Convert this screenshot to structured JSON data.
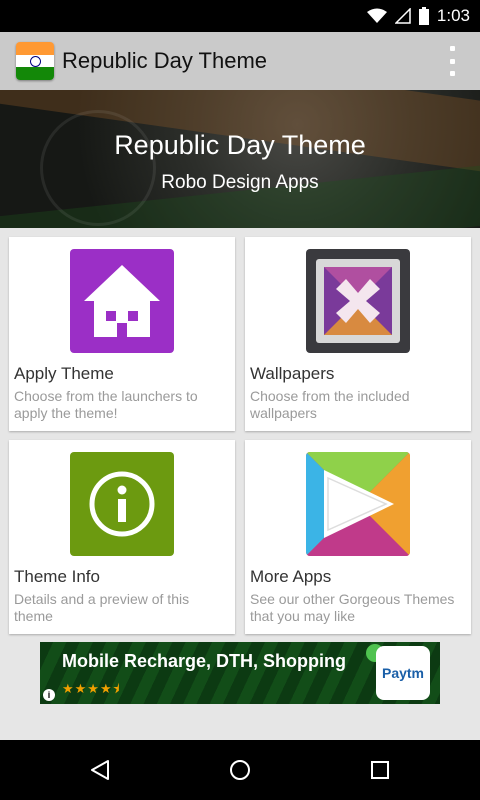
{
  "status_bar": {
    "time": "1:03",
    "icons": [
      "wifi-icon",
      "signal-icon",
      "battery-icon"
    ]
  },
  "action_bar": {
    "title": "Republic Day Theme",
    "icons": [
      "india-flag-icon",
      "overflow-menu-icon"
    ]
  },
  "hero": {
    "title": "Republic Day Theme",
    "subtitle": "Robo Design Apps"
  },
  "cards": [
    {
      "title": "Apply Theme",
      "description": "Choose from the launchers to apply the theme!",
      "icon": "home-icon",
      "color": "#9b2fc6"
    },
    {
      "title": "Wallpapers",
      "description": "Choose from the included wallpapers",
      "icon": "wallpaper-icon",
      "color": "#3a3a3e"
    },
    {
      "title": "Theme Info",
      "description": "Details and a preview of this theme",
      "icon": "info-icon",
      "color": "#6c9a10"
    },
    {
      "title": "More Apps",
      "description": "See our other Gorgeous Themes that you may like",
      "icon": "play-store-icon",
      "color": "#e04a3a"
    }
  ],
  "ad": {
    "title": "Mobile Recharge, DTH, Shopping",
    "stars": "★★★★⯨",
    "brand": "Paytm"
  },
  "nav_bar": {
    "icons": [
      "back-icon",
      "home-nav-icon",
      "recents-icon"
    ]
  }
}
